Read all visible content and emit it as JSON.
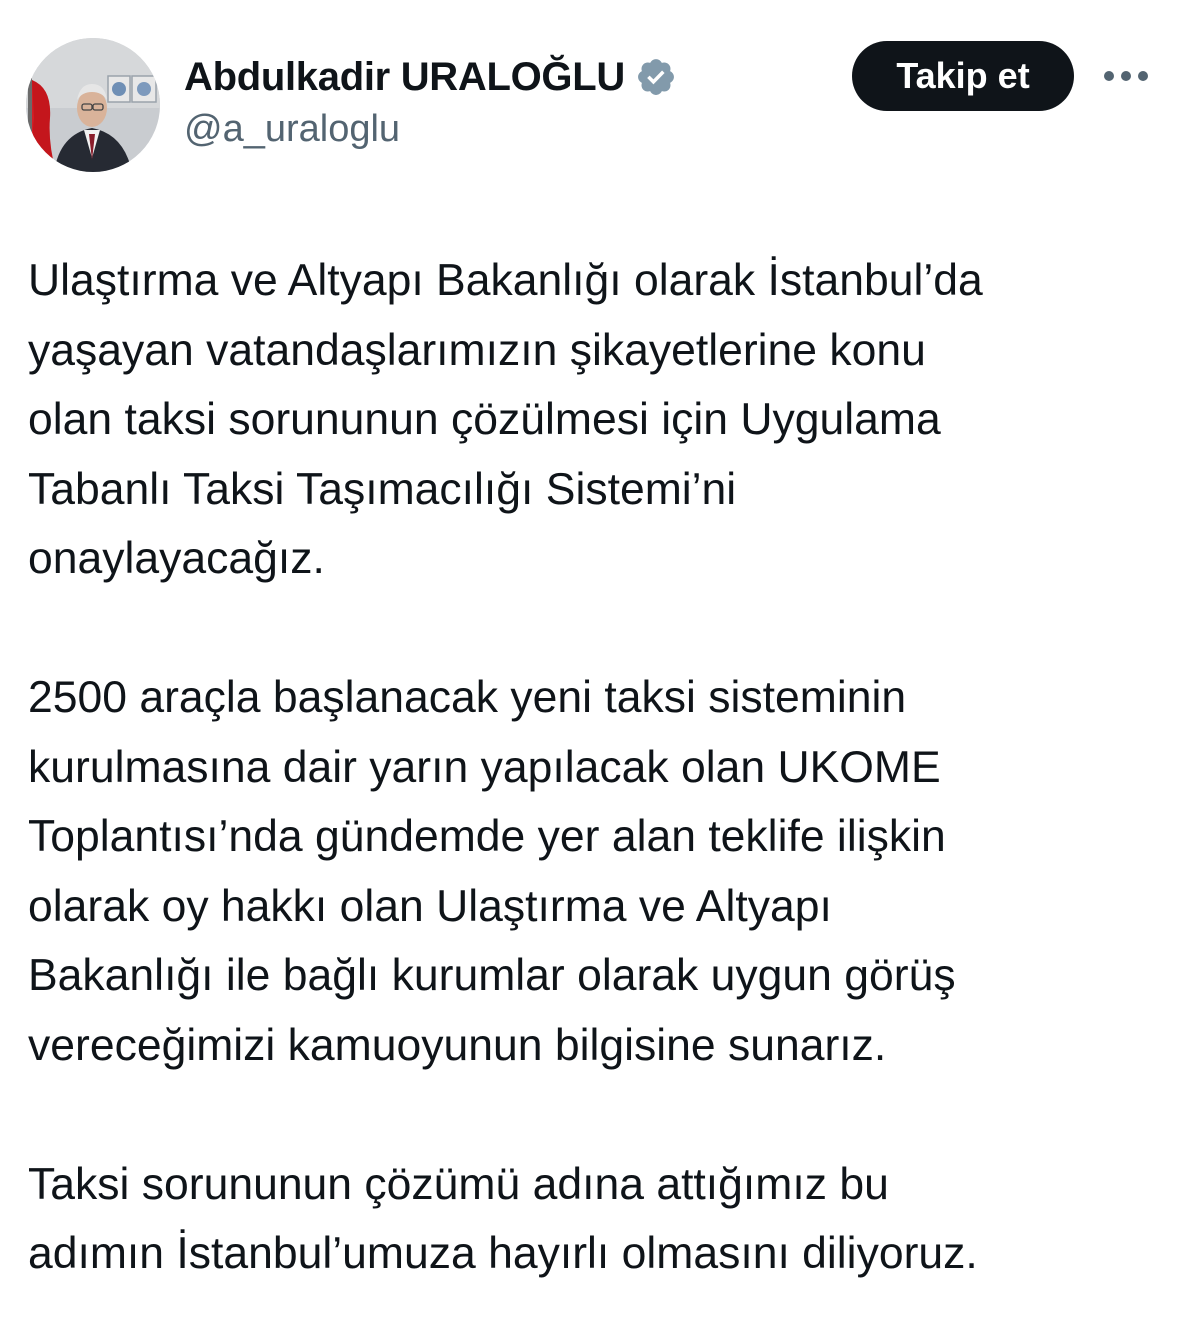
{
  "user": {
    "display_name": "Abdulkadir URALOĞLU",
    "handle": "@a_uraloglu",
    "verified_badge_icon": "verified-badge-icon",
    "verified_badge_color": "#829aab",
    "avatar_icon": "profile-photo"
  },
  "actions": {
    "follow_label": "Takip et",
    "more_icon": "more-horizontal-icon"
  },
  "tweet": {
    "paragraphs": [
      [
        "Ulaştırma ve Altyapı Bakanlığı olarak İstanbul’da",
        "yaşayan vatandaşlarımızın şikayetlerine konu",
        "olan taksi sorununun çözülmesi için Uygulama",
        "Tabanlı Taksi Taşımacılığı Sistemi’ni",
        "onaylayacağız."
      ],
      [
        "2500 araçla başlanacak yeni taksi sisteminin",
        "kurulmasına dair yarın yapılacak olan UKOME",
        "Toplantısı’nda gündemde yer alan teklife ilişkin",
        "olarak oy hakkı olan Ulaştırma ve Altyapı",
        "Bakanlığı ile bağlı kurumlar olarak uygun görüş",
        "vereceğimizi kamuoyunun bilgisine sunarız."
      ],
      [
        "Taksi sorununun çözümü adına attığımız bu",
        "adımın İstanbul’umuza hayırlı olmasını diliyoruz."
      ]
    ]
  },
  "colors": {
    "text_primary": "#0f1419",
    "text_secondary": "#536471",
    "button_bg": "#0f1419",
    "button_text": "#ffffff"
  }
}
